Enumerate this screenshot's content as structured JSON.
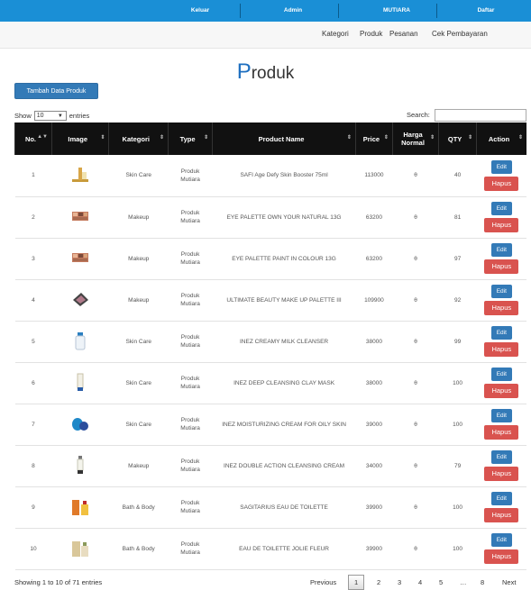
{
  "topnav": {
    "items": [
      "Keluar",
      "Admin",
      "MUTIARA",
      "Daftar"
    ],
    "bg": "#1a8fd6"
  },
  "subnav": {
    "items": [
      "Kategori",
      "Produk",
      "Pesanan",
      "Cek Pembayaran"
    ]
  },
  "page": {
    "title_first": "P",
    "title_rest": "roduk"
  },
  "add_button": "Tambah Data Produk",
  "length": {
    "prefix": "Show",
    "value": "10",
    "suffix": "entries"
  },
  "search_label": "Search:",
  "columns": [
    "No.",
    "Image",
    "Kategori",
    "Type",
    "Product Name",
    "Price",
    "Harga Normal",
    "QTY",
    "Action"
  ],
  "rows": [
    {
      "no": "1",
      "image": "bottle-stand-icon",
      "kategori": "Skin Care",
      "type": "Produk Mutiara",
      "name": "SAFI Age Defy Skin Booster 75ml",
      "price": "113000",
      "normal": "θ",
      "qty": "40"
    },
    {
      "no": "2",
      "image": "palette-icon",
      "kategori": "Makeup",
      "type": "Produk Mutiara",
      "name": "EYE PALETTE OWN YOUR NATURAL 13G",
      "price": "63200",
      "normal": "θ",
      "qty": "81"
    },
    {
      "no": "3",
      "image": "palette-icon",
      "kategori": "Makeup",
      "type": "Produk Mutiara",
      "name": "EYE PALETTE PAINT IN COLOUR 13G",
      "price": "63200",
      "normal": "θ",
      "qty": "97"
    },
    {
      "no": "4",
      "image": "compact-icon",
      "kategori": "Makeup",
      "type": "Produk Mutiara",
      "name": "ULTIMATE BEAUTY MAKE UP PALETTE III",
      "price": "109900",
      "normal": "θ",
      "qty": "92"
    },
    {
      "no": "5",
      "image": "bottle-icon",
      "kategori": "Skin Care",
      "type": "Produk Mutiara",
      "name": "INEZ CREAMY MILK CLEANSER",
      "price": "38000",
      "normal": "θ",
      "qty": "99"
    },
    {
      "no": "6",
      "image": "tube-icon",
      "kategori": "Skin Care",
      "type": "Produk Mutiara",
      "name": "INEZ DEEP CLEANSING CLAY MASK",
      "price": "38000",
      "normal": "θ",
      "qty": "100"
    },
    {
      "no": "7",
      "image": "jar-icon",
      "kategori": "Skin Care",
      "type": "Produk Mutiara",
      "name": "INEZ MOISTURIZING CREAM FOR OILY SKIN",
      "price": "39000",
      "normal": "θ",
      "qty": "100"
    },
    {
      "no": "8",
      "image": "pump-bottle-icon",
      "kategori": "Makeup",
      "type": "Produk Mutiara",
      "name": "INEZ DOUBLE ACTION CLEANSING CREAM",
      "price": "34000",
      "normal": "θ",
      "qty": "79"
    },
    {
      "no": "9",
      "image": "perfume-icon",
      "kategori": "Bath & Body",
      "type": "Produk Mutiara",
      "name": "SAGITARIUS EAU DE TOILETTE",
      "price": "39900",
      "normal": "θ",
      "qty": "100"
    },
    {
      "no": "10",
      "image": "perfume-box-icon",
      "kategori": "Bath & Body",
      "type": "Produk Mutiara",
      "name": "EAU DE TOILETTE JOLIE FLEUR",
      "price": "39900",
      "normal": "θ",
      "qty": "100"
    }
  ],
  "action_labels": {
    "edit": "Edit",
    "delete": "Hapus"
  },
  "info": "Showing 1 to 10 of 71 entries",
  "pagination": {
    "previous": "Previous",
    "pages": [
      "1",
      "2",
      "3",
      "4",
      "5"
    ],
    "ellipsis": "…",
    "last": "8",
    "next": "Next"
  },
  "colors": {
    "primary": "#337ab7",
    "danger": "#d9534f",
    "header": "#111111"
  }
}
